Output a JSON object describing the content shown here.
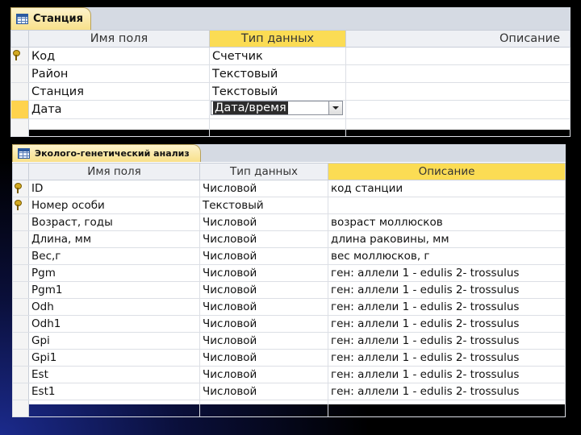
{
  "table1": {
    "tab_title": "Станция",
    "headers": [
      "Имя поля",
      "Тип данных",
      "Описание"
    ],
    "rows": [
      {
        "name": "Код",
        "type": "Счетчик",
        "desc": ""
      },
      {
        "name": "Район",
        "type": "Текстовый",
        "desc": ""
      },
      {
        "name": "Станция",
        "type": "Текстовый",
        "desc": ""
      },
      {
        "name": "Дата",
        "type": "Дата/время",
        "desc": ""
      }
    ],
    "key_rows": [
      0
    ],
    "active_row": 3
  },
  "table2": {
    "tab_title": "Эколого-генетический анализ",
    "headers": [
      "Имя поля",
      "Тип данных",
      "Описание"
    ],
    "rows": [
      {
        "name": "ID",
        "type": "Числовой",
        "desc": "код станции"
      },
      {
        "name": "Номер особи",
        "type": "Текстовый",
        "desc": ""
      },
      {
        "name": "Возраст, годы",
        "type": "Числовой",
        "desc": "возраст моллюсков"
      },
      {
        "name": "Длина, мм",
        "type": "Числовой",
        "desc": "длина раковины, мм"
      },
      {
        "name": "Вес,г",
        "type": "Числовой",
        "desc": "вес моллюсков, г"
      },
      {
        "name": "Pgm",
        "type": "Числовой",
        "desc": "ген: аллели 1 - edulis 2- trossulus"
      },
      {
        "name": "Pgm1",
        "type": "Числовой",
        "desc": "ген: аллели 1 - edulis 2- trossulus"
      },
      {
        "name": "Odh",
        "type": "Числовой",
        "desc": "ген: аллели 1 - edulis 2- trossulus"
      },
      {
        "name": "Odh1",
        "type": "Числовой",
        "desc": "ген: аллели 1 - edulis 2- trossulus"
      },
      {
        "name": "Gpi",
        "type": "Числовой",
        "desc": "ген: аллели 1 - edulis 2- trossulus"
      },
      {
        "name": "Gpi1",
        "type": "Числовой",
        "desc": "ген: аллели 1 - edulis 2- trossulus"
      },
      {
        "name": "Est",
        "type": "Числовой",
        "desc": "ген: аллели 1 - edulis 2- trossulus"
      },
      {
        "name": "Est1",
        "type": "Числовой",
        "desc": "ген: аллели 1 - edulis 2- trossulus"
      }
    ],
    "key_rows": [
      0,
      1
    ],
    "highlight_header": "Описание"
  }
}
